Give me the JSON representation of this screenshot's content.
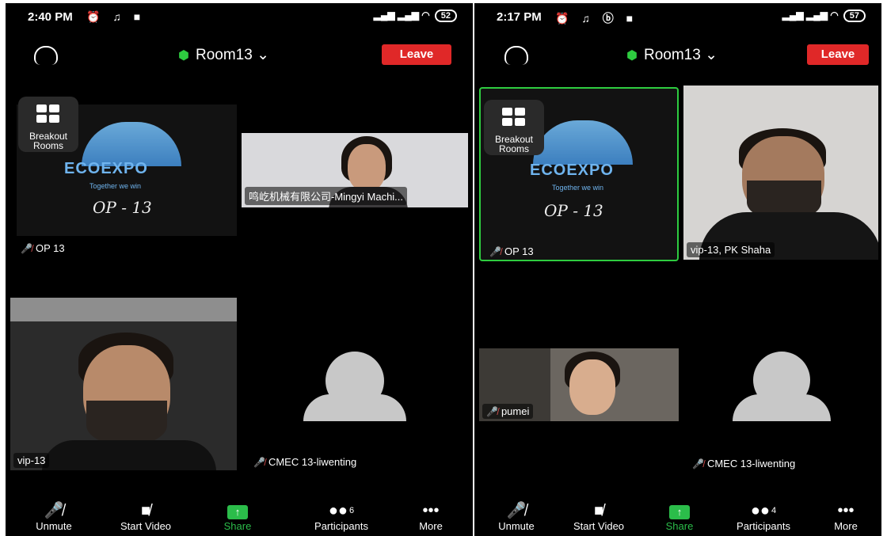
{
  "left": {
    "status": {
      "time": "2:40 PM",
      "battery": "52"
    },
    "room": {
      "name": "Room13",
      "leave": "Leave"
    },
    "breakout": {
      "label": "Breakout Rooms"
    },
    "eco": {
      "logo": "ECOEXPO",
      "tagline": "Together we win",
      "op": "OP - 13"
    },
    "tiles": {
      "op13": "OP 13",
      "mingyi": "鸣屹机械有限公司-Mingyi Machi...",
      "vip13": "vip-13",
      "cmec": "CMEC 13-liwenting"
    },
    "toolbar": {
      "unmute": "Unmute",
      "video": "Start Video",
      "share": "Share",
      "participants": "Participants",
      "count": "6",
      "more": "More"
    }
  },
  "right": {
    "status": {
      "time": "2:17 PM",
      "battery": "57"
    },
    "room": {
      "name": "Room13",
      "leave": "Leave"
    },
    "breakout": {
      "label": "Breakout Rooms"
    },
    "eco": {
      "logo": "ECOEXPO",
      "tagline": "Together we win",
      "op": "OP - 13"
    },
    "tiles": {
      "op13": "OP 13",
      "pkshaha": "vip-13, PK Shaha",
      "pumei": "pumei",
      "cmec": "CMEC 13-liwenting"
    },
    "toolbar": {
      "unmute": "Unmute",
      "video": "Start Video",
      "share": "Share",
      "participants": "Participants",
      "count": "4",
      "more": "More"
    }
  },
  "colors": {
    "leave": "#e02828",
    "share": "#2bbd4a",
    "active_border": "#2ecc40"
  }
}
